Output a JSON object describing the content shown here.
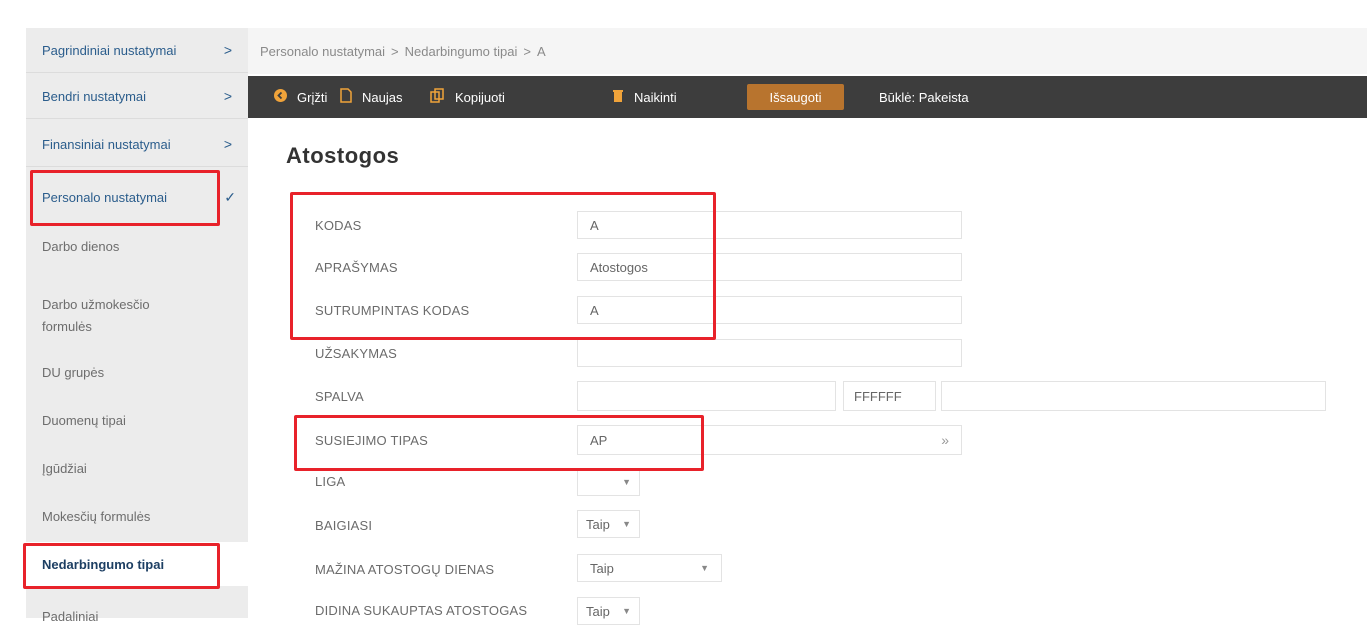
{
  "sidebar": {
    "items": [
      {
        "label": "Pagrindiniai nustatymai",
        "chevron": ">"
      },
      {
        "label": "Bendri nustatymai",
        "chevron": ">"
      },
      {
        "label": "Finansiniai nustatymai",
        "chevron": ">"
      },
      {
        "label": "Personalo nustatymai",
        "chevron": "✓"
      },
      {
        "label": "Darbo dienos"
      },
      {
        "label": "Darbo užmokesčio formulės"
      },
      {
        "label": "DU grupės"
      },
      {
        "label": "Duomenų tipai"
      },
      {
        "label": "Įgūdžiai"
      },
      {
        "label": "Mokesčių formulės"
      },
      {
        "label": "Nedarbingumo tipai"
      },
      {
        "label": "Padaliniai"
      }
    ]
  },
  "breadcrumb": {
    "items": [
      "Personalo nustatymai",
      "Nedarbingumo tipai",
      "A"
    ],
    "separator": ">"
  },
  "toolbar": {
    "back": "Grįžti",
    "new": "Naujas",
    "copy": "Kopijuoti",
    "delete": "Naikinti",
    "save": "Išsaugoti",
    "state": "Būklė: Pakeista"
  },
  "form": {
    "title": "Atostogos",
    "kodas": {
      "label": "KODAS",
      "value": "A"
    },
    "aprasymas": {
      "label": "APRAŠYMAS",
      "value": "Atostogos"
    },
    "sutrumpintas": {
      "label": "SUTRUMPINTAS KODAS",
      "value": "A"
    },
    "uzsakymas": {
      "label": "UŽSAKYMAS",
      "value": ""
    },
    "spalva": {
      "label": "SPALVA",
      "value": "",
      "hex": "FFFFFF"
    },
    "susiejimo": {
      "label": "SUSIEJIMO TIPAS",
      "value": "AP",
      "button": "»"
    },
    "liga": {
      "label": "LIGA",
      "value": ""
    },
    "baigiasi": {
      "label": "BAIGIASI",
      "value": "Taip"
    },
    "mazina": {
      "label": "MAŽINA ATOSTOGŲ DIENAS",
      "value": "Taip"
    },
    "didina": {
      "label": "DIDINA SUKAUPTAS ATOSTOGAS",
      "value": "Taip"
    }
  },
  "colors": {
    "highlight": "#e8222a",
    "save_button": "#b8742e",
    "toolbar_bg": "#3d3d3d",
    "sidebar_link": "#2b5d8c"
  }
}
